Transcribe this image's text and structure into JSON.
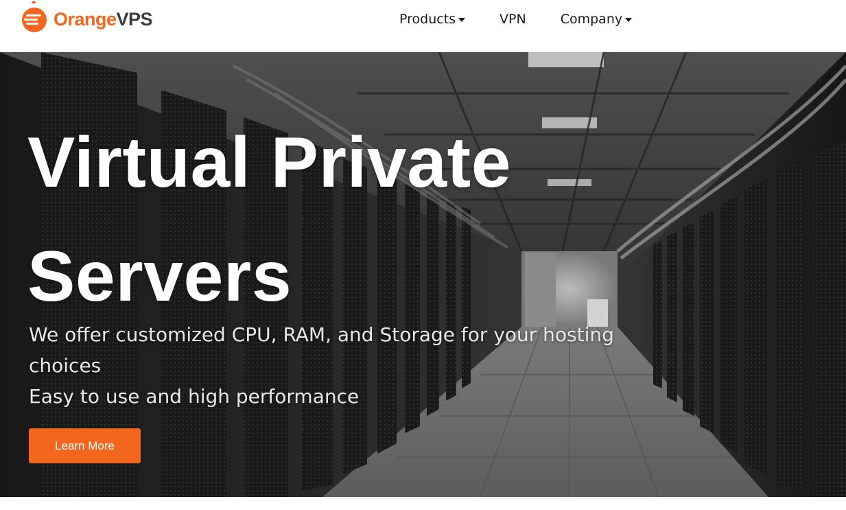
{
  "brand": {
    "name_part1": "Orange",
    "name_part2": "VPS",
    "accent_color": "#f2661e",
    "text_color": "#3c3c3c",
    "logo_icon": "orange-fruit-icon"
  },
  "nav": {
    "items": [
      {
        "label": "Products",
        "has_dropdown": true
      },
      {
        "label": "VPN",
        "has_dropdown": false
      },
      {
        "label": "Company",
        "has_dropdown": true
      }
    ]
  },
  "hero": {
    "title_line1": "Virtual Private",
    "title_line2": "Servers",
    "subtitle_line1": "We offer customized CPU, RAM, and Storage for your hosting choices",
    "subtitle_line2": "Easy to use and high performance",
    "cta_label": "Learn More",
    "background": "server-room-corridor-image"
  }
}
